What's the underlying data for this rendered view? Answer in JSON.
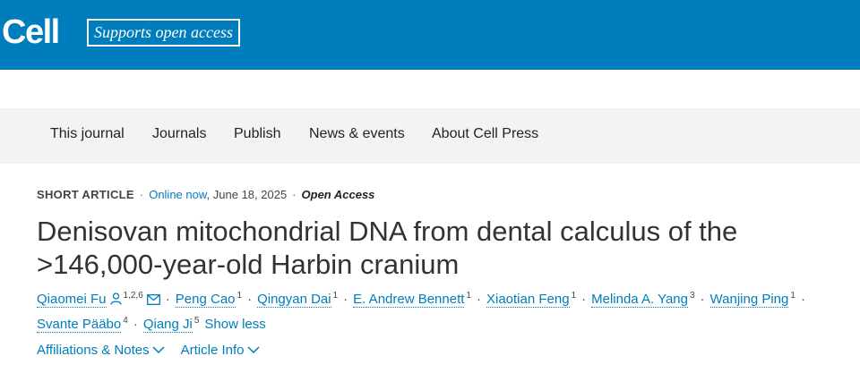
{
  "header": {
    "logo_text": "Cell",
    "badge_label": "Supports open access",
    "bg_color": "#007dbc"
  },
  "nav": {
    "items": [
      "This journal",
      "Journals",
      "Publish",
      "News & events",
      "About Cell Press"
    ]
  },
  "article": {
    "type": "SHORT ARTICLE",
    "online_label": "Online now",
    "date": "June 18, 2025",
    "access": "Open Access",
    "title": "Denisovan mitochondrial DNA from dental calculus of the >146,000-year-old Harbin cranium",
    "authors": [
      {
        "name": "Qiaomei Fu",
        "sup": "1,2,6",
        "icons": [
          "person-icon",
          "envelope-icon"
        ]
      },
      {
        "name": "Peng Cao",
        "sup": "1"
      },
      {
        "name": "Qingyan Dai",
        "sup": "1"
      },
      {
        "name": "E. Andrew Bennett",
        "sup": "1"
      },
      {
        "name": "Xiaotian Feng",
        "sup": "1"
      },
      {
        "name": "Melinda A. Yang",
        "sup": "3"
      },
      {
        "name": "Wanjing Ping",
        "sup": "1"
      },
      {
        "name": "Svante Pääbo",
        "sup": "4"
      },
      {
        "name": "Qiang Ji",
        "sup": "5"
      }
    ],
    "show_less": "Show less",
    "affiliations_label": "Affiliations & Notes",
    "article_info_label": "Article Info"
  }
}
